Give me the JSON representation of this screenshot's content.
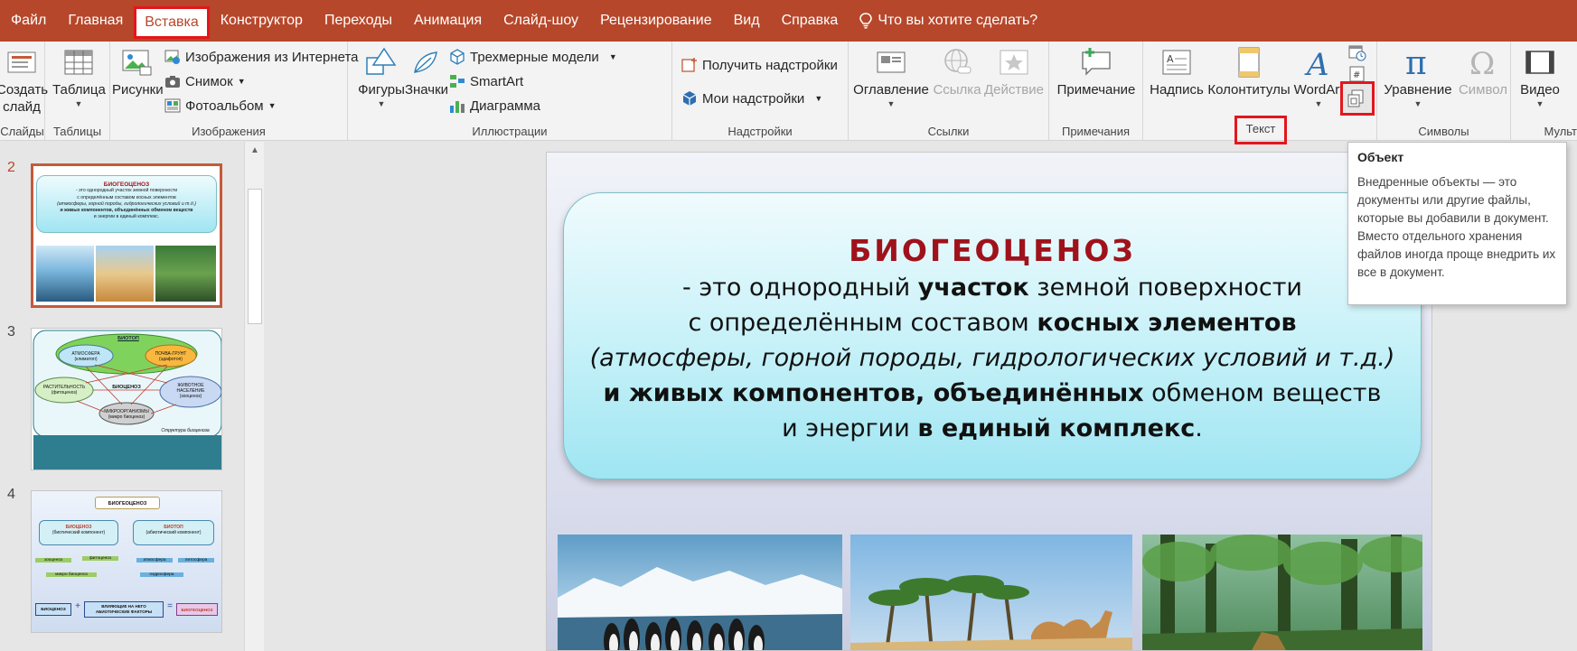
{
  "menu": {
    "tabs": [
      "Файл",
      "Главная",
      "Вставка",
      "Конструктор",
      "Переходы",
      "Анимация",
      "Слайд-шоу",
      "Рецензирование",
      "Вид",
      "Справка"
    ],
    "active_tab": "Вставка",
    "tell_me": "Что вы хотите сделать?"
  },
  "ribbon": {
    "slides": {
      "new_slide": "Создать слайд",
      "label": "Слайды"
    },
    "tables": {
      "table": "Таблица",
      "label": "Таблицы"
    },
    "images": {
      "pictures": "Рисунки",
      "online": "Изображения из Интернета",
      "screenshot": "Снимок",
      "album": "Фотоальбом",
      "label": "Изображения"
    },
    "illustrations": {
      "shapes": "Фигуры",
      "icons": "Значки",
      "models3d": "Трехмерные модели",
      "smartart": "SmartArt",
      "chart": "Диаграмма",
      "label": "Иллюстрации"
    },
    "addins": {
      "get": "Получить надстройки",
      "my": "Мои надстройки",
      "label": "Надстройки"
    },
    "links": {
      "toc": "Оглавление",
      "link": "Ссылка",
      "action": "Действие",
      "label": "Ссылки"
    },
    "comments": {
      "comment": "Примечание",
      "label": "Примечания"
    },
    "text": {
      "textbox": "Надпись",
      "headers": "Колонтитулы",
      "wordart": "WordArt",
      "label": "Текст"
    },
    "symbols": {
      "equation": "Уравнение",
      "symbol": "Символ",
      "label": "Символы"
    },
    "media": {
      "video": "Видео",
      "label": "Мульт"
    }
  },
  "thumbnails": [
    {
      "number": "2",
      "selected": true
    },
    {
      "number": "3",
      "selected": false
    },
    {
      "number": "4",
      "selected": false
    }
  ],
  "thumb2": {
    "title": "БИОГЕОЦЕНОЗ",
    "lines": [
      "- это однородный участок земной поверхности",
      "с определённым составом косных элементов",
      "(атмосферы, горной породы, гидрологических условий и т.д.)",
      "и живых компонентов, объединённых обменом веществ",
      "и энергии в единый комплекс."
    ]
  },
  "thumb3": {
    "top": "БИОТОП",
    "atm": "АТМОСФЕРА",
    "atm_sub": "(климатоп)",
    "soil": "ПОЧВА-ГРУНТ",
    "soil_sub": "(эдафотоп)",
    "center": "БИОЦЕНОЗ",
    "plants": "РАСТИТЕЛЬНОСТЬ",
    "plants_sub": "(фитоценоз)",
    "animals": "ЖИВОТНОЕ НАСЕЛЕНИЕ",
    "animals_sub": "(зооценоз)",
    "micro": "МИКРООРГАНИЗМЫ",
    "micro_sub": "(микро биоценоз)",
    "caption": "Структура биоценоза"
  },
  "thumb4": {
    "top": "БИОГЕОЦЕНОЗ",
    "left": "БИОЦЕНОЗ",
    "left_sub": "(биотический компонент)",
    "right": "БИОТОП",
    "right_sub": "(абиотический компонент)",
    "l1": "зооценоз",
    "l2": "фитоценоз",
    "l3": "микро биоценоз",
    "r1": "атмосфера",
    "r2": "литосфера",
    "r3": "гидросфера",
    "b1": "БИОЦЕНОЗ",
    "b2": "ВЛИЯЮЩИЕ НА НЕГО АБИОТИЧЕСКИЕ ФАКТОРЫ",
    "b3": "БИОГЕОЦЕНОЗ"
  },
  "slide": {
    "title": "БИОГЕОЦЕНОЗ",
    "line1_a": "- это однородный ",
    "line1_b": "участок",
    "line1_c": " земной поверхности",
    "line2_a": "с определённым составом ",
    "line2_b": "косных элементов",
    "line3": "(атмосферы, горной породы, гидрологических  условий и т.д.)",
    "line4_a": "и живых компонентов",
    "line4_b": ", ",
    "line4_c": "объединённых",
    "line4_d": "  обменом веществ",
    "line5_a": "и энергии ",
    "line5_b": "в единый комплекс",
    "line5_c": "."
  },
  "tooltip": {
    "title": "Объект",
    "body": "Внедренные объекты — это документы или другие файлы, которые вы добавили в документ. Вместо отдельного хранения файлов иногда проще внедрить их все в документ."
  }
}
